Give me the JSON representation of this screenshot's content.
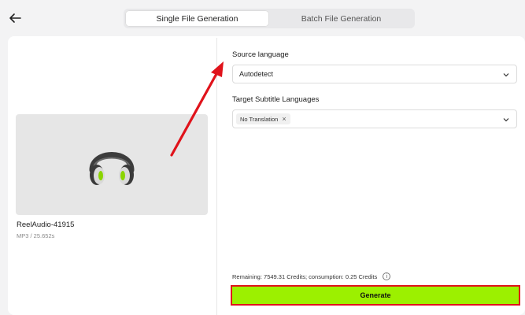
{
  "tabs": [
    {
      "label": "Single File Generation",
      "active": true
    },
    {
      "label": "Batch File Generation",
      "active": false
    }
  ],
  "file": {
    "name": "ReelAudio-41915",
    "meta": "MP3 / 25.652s",
    "thumbnail_icon": "headphones-icon"
  },
  "source_language": {
    "label": "Source language",
    "value": "Autodetect"
  },
  "target_languages": {
    "label": "Target Subtitle Languages",
    "tags": [
      "No Translation"
    ]
  },
  "credits_text": "Remaining: 7549.31 Credits; consumption: 0.25 Credits",
  "generate_label": "Generate",
  "colors": {
    "accent": "#9cf000",
    "highlight_border": "#e0131b",
    "annotation_arrow": "#e0131b"
  }
}
